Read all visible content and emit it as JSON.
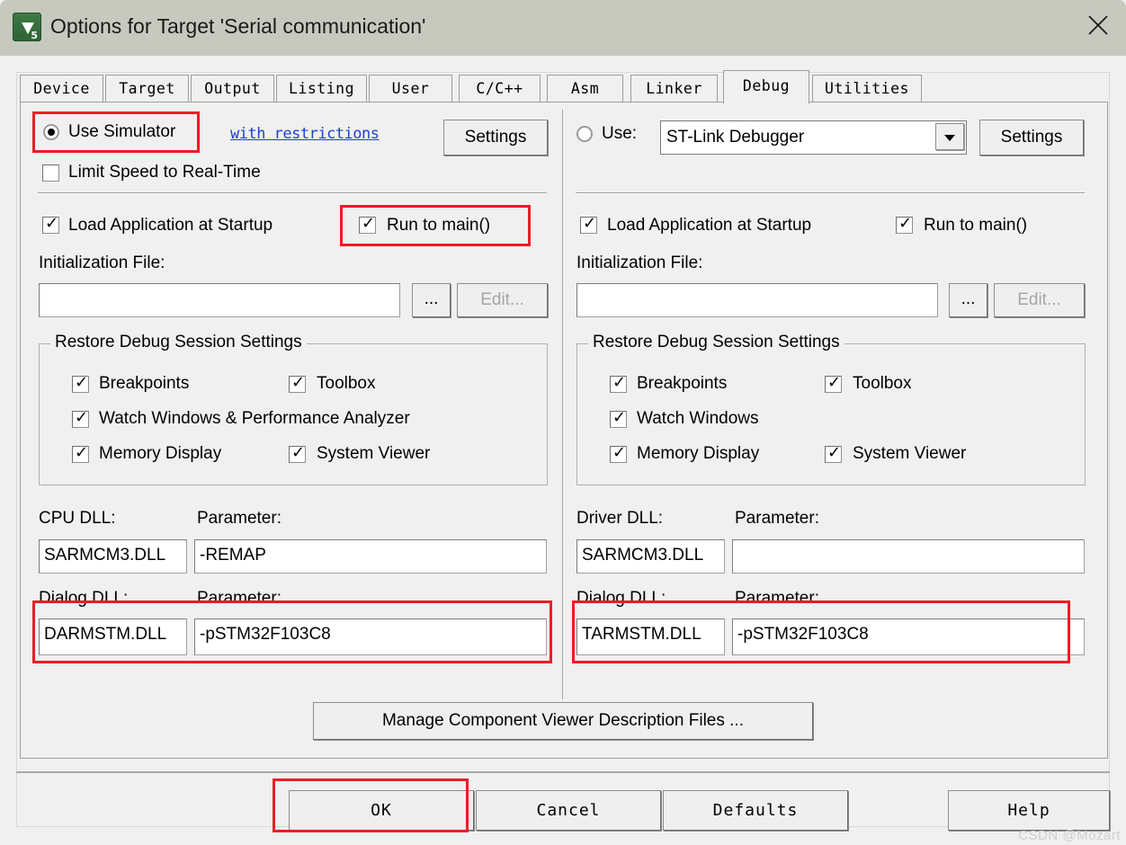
{
  "window": {
    "title": "Options for Target 'Serial communication'",
    "icon": "keil-uvision5-icon",
    "close_label": "close-icon",
    "titlebar_color": "#c7c9bf",
    "accent_red": "#ee1c25",
    "link_color": "#1f3fd4"
  },
  "tabs": [
    {
      "label": "Device",
      "active": false
    },
    {
      "label": "Target",
      "active": false
    },
    {
      "label": "Output",
      "active": false
    },
    {
      "label": "Listing",
      "active": false
    },
    {
      "label": "User",
      "active": false
    },
    {
      "label": "C/C++",
      "active": false
    },
    {
      "label": "Asm",
      "active": false
    },
    {
      "label": "Linker",
      "active": false
    },
    {
      "label": "Debug",
      "active": true
    },
    {
      "label": "Utilities",
      "active": false
    }
  ],
  "left": {
    "use_simulator": {
      "label": "Use Simulator",
      "checked": true
    },
    "with_restrictions_link": "with restrictions",
    "settings_button": "Settings",
    "limit_speed": {
      "label": "Limit Speed to Real-Time",
      "checked": false
    },
    "load_app": {
      "label": "Load Application at Startup",
      "checked": true
    },
    "run_to_main": {
      "label": "Run to main()",
      "checked": true
    },
    "init_file_label": "Initialization File:",
    "init_file_value": "",
    "browse_button": "...",
    "edit_button": "Edit...",
    "edit_disabled": true,
    "restore_group": {
      "title": "Restore Debug Session Settings",
      "items": [
        {
          "label": "Breakpoints",
          "checked": true
        },
        {
          "label": "Toolbox",
          "checked": true
        },
        {
          "label": "Watch Windows & Performance Analyzer",
          "checked": true
        },
        {
          "label": "Memory Display",
          "checked": true
        },
        {
          "label": "System Viewer",
          "checked": true
        }
      ]
    },
    "cpu_dll_label": "CPU DLL:",
    "cpu_dll_value": "SARMCM3.DLL",
    "cpu_param_label": "Parameter:",
    "cpu_param_value": "-REMAP",
    "dialog_dll_label": "Dialog DLL:",
    "dialog_dll_value": "DARMSTM.DLL",
    "dialog_param_label": "Parameter:",
    "dialog_param_value": "-pSTM32F103C8"
  },
  "right": {
    "use_radio": {
      "label": "Use:",
      "checked": false
    },
    "debugger_value": "ST-Link Debugger",
    "settings_button": "Settings",
    "load_app": {
      "label": "Load Application at Startup",
      "checked": true
    },
    "run_to_main": {
      "label": "Run to main()",
      "checked": true
    },
    "init_file_label": "Initialization File:",
    "init_file_value": "",
    "browse_button": "...",
    "edit_button": "Edit...",
    "edit_disabled": true,
    "restore_group": {
      "title": "Restore Debug Session Settings",
      "items": [
        {
          "label": "Breakpoints",
          "checked": true
        },
        {
          "label": "Toolbox",
          "checked": true
        },
        {
          "label": "Watch Windows",
          "checked": true
        },
        {
          "label": "Memory Display",
          "checked": true
        },
        {
          "label": "System Viewer",
          "checked": true
        }
      ]
    },
    "driver_dll_label": "Driver DLL:",
    "driver_dll_value": "SARMCM3.DLL",
    "driver_param_label": "Parameter:",
    "driver_param_value": "",
    "dialog_dll_label": "Dialog DLL:",
    "dialog_dll_value": "TARMSTM.DLL",
    "dialog_param_label": "Parameter:",
    "dialog_param_value": "-pSTM32F103C8"
  },
  "manage_button": "Manage Component Viewer Description Files ...",
  "footer": {
    "ok": "OK",
    "cancel": "Cancel",
    "defaults": "Defaults",
    "help": "Help"
  },
  "watermark": "CSDN @Mozart"
}
